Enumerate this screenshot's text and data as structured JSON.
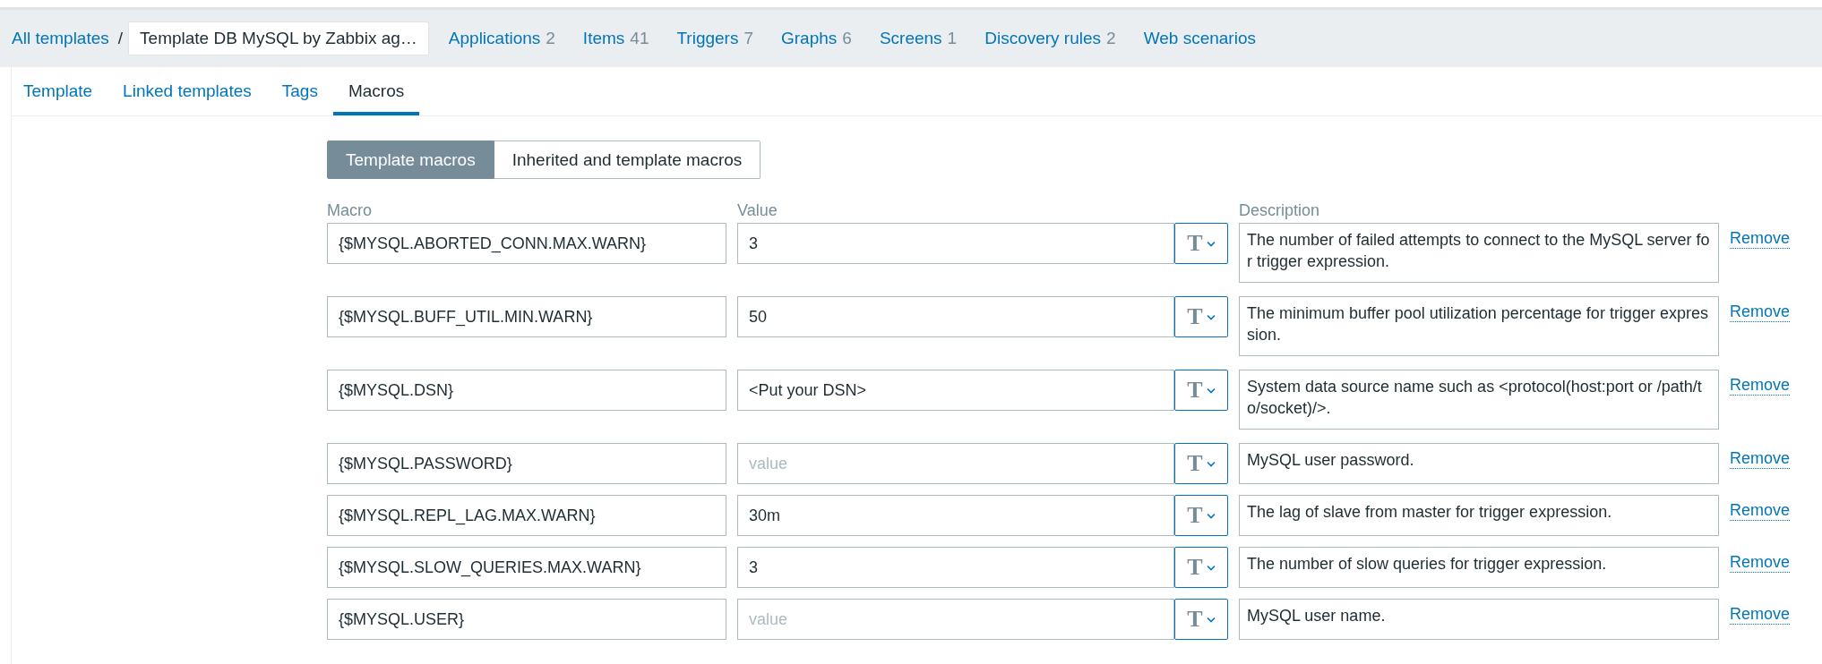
{
  "breadcrumb": {
    "root": "All templates",
    "separator": "/",
    "current": "Template DB MySQL by Zabbix ag…"
  },
  "nav": [
    {
      "label": "Applications",
      "count": "2"
    },
    {
      "label": "Items",
      "count": "41"
    },
    {
      "label": "Triggers",
      "count": "7"
    },
    {
      "label": "Graphs",
      "count": "6"
    },
    {
      "label": "Screens",
      "count": "1"
    },
    {
      "label": "Discovery rules",
      "count": "2"
    },
    {
      "label": "Web scenarios"
    }
  ],
  "tabs": [
    {
      "label": "Template",
      "selected": false
    },
    {
      "label": "Linked templates",
      "selected": false
    },
    {
      "label": "Tags",
      "selected": false
    },
    {
      "label": "Macros",
      "selected": true
    }
  ],
  "macro_view": [
    {
      "label": "Template macros",
      "selected": true
    },
    {
      "label": "Inherited and template macros",
      "selected": false
    }
  ],
  "columns": [
    "Macro",
    "Value",
    "Description"
  ],
  "macros": [
    {
      "macro": "{$MYSQL.ABORTED_CONN.MAX.WARN}",
      "value": "3",
      "type_symbol": "T",
      "description": "The number of failed attempts to connect to the MySQL server for trigger expression.",
      "action": "Remove"
    },
    {
      "macro": "{$MYSQL.BUFF_UTIL.MIN.WARN}",
      "value": "50",
      "type_symbol": "T",
      "description": "The minimum buffer pool utilization percentage for trigger expression.",
      "action": "Remove"
    },
    {
      "macro": "{$MYSQL.DSN}",
      "value": "<Put your DSN>",
      "type_symbol": "T",
      "description": "System data source name such as <protocol(host:port or /path/to/socket)/>.",
      "action": "Remove"
    },
    {
      "macro": "{$MYSQL.PASSWORD}",
      "placeholder": "value",
      "type_symbol": "T",
      "description": "MySQL user password.",
      "action": "Remove"
    },
    {
      "macro": "{$MYSQL.REPL_LAG.MAX.WARN}",
      "value": "30m",
      "type_symbol": "T",
      "description": "The lag of slave from master for trigger expression.",
      "action": "Remove"
    },
    {
      "macro": "{$MYSQL.SLOW_QUERIES.MAX.WARN}",
      "value": "3",
      "type_symbol": "T",
      "description": "The number of slow queries for trigger expression.",
      "action": "Remove"
    },
    {
      "macro": "{$MYSQL.USER}",
      "placeholder": "value",
      "type_symbol": "T",
      "description": "MySQL user name.",
      "action": "Remove"
    }
  ]
}
